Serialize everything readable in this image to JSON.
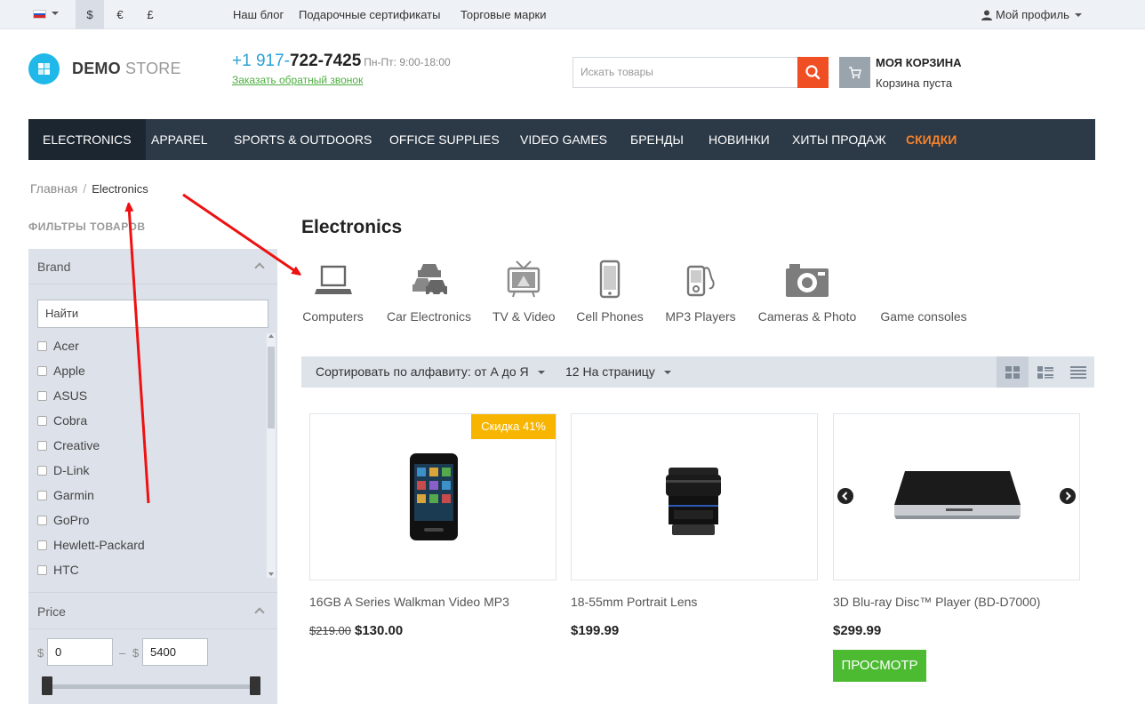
{
  "topbar": {
    "currencies": [
      "$",
      "€",
      "£"
    ],
    "links": [
      "Наш блог",
      "Подарочные сертификаты",
      "Торговые марки"
    ],
    "profile_label": "Мой профиль"
  },
  "header": {
    "logo_bold": "DEMO",
    "logo_light": "STORE",
    "phone_prefix": "+1 917-",
    "phone_number": "722-7425",
    "hours": "Пн-Пт: 9:00-18:00",
    "callback_link": "Заказать обратный звонок",
    "search_placeholder": "Искать товары",
    "cart_title": "МОЯ КОРЗИНА",
    "cart_status": "Корзина пуста"
  },
  "nav": [
    "ELECTRONICS",
    "APPAREL",
    "SPORTS & OUTDOORS",
    "OFFICE SUPPLIES",
    "VIDEO GAMES",
    "БРЕНДЫ",
    "НОВИНКИ",
    "ХИТЫ ПРОДАЖ",
    "СКИДКИ"
  ],
  "breadcrumb": {
    "home": "Главная",
    "separator": "/",
    "current": "Electronics"
  },
  "filters": {
    "title": "ФИЛЬТРЫ ТОВАРОВ",
    "brand_heading": "Brand",
    "brand_search_placeholder": "Найти",
    "brands": [
      "Acer",
      "Apple",
      "ASUS",
      "Cobra",
      "Creative",
      "D-Link",
      "Garmin",
      "GoPro",
      "Hewlett-Packard",
      "HTC"
    ],
    "price_heading": "Price",
    "currency_symbol": "$",
    "price_dash": "–",
    "price_min": "0",
    "price_max": "5400"
  },
  "content": {
    "title": "Electronics",
    "categories": [
      "Computers",
      "Car Electronics",
      "TV & Video",
      "Cell Phones",
      "MP3 Players",
      "Cameras & Photo",
      "Game consoles"
    ],
    "sort_label": "Сортировать по алфавиту: от А до Я",
    "per_page_label": "12 На страницу",
    "products": [
      {
        "name": "16GB A Series Walkman Video MP3",
        "old_price": "$219.00",
        "price": "$130.00",
        "badge": "Скидка 41%"
      },
      {
        "name": "18-55mm Portrait Lens",
        "price": "$199.99"
      },
      {
        "name": "3D Blu-ray Disc™ Player (BD-D7000)",
        "price": "$299.99",
        "button": "ПРОСМОТР"
      }
    ]
  },
  "icons": [
    "flag-ru-icon",
    "user-icon",
    "search-icon",
    "cart-icon",
    "grid-view-icon",
    "list-view-icon",
    "compact-view-icon",
    "arrow-annotation-icon"
  ],
  "colors": {
    "nav_bg": "#2c3947",
    "sale": "#f5822a",
    "search_btn": "#f04e23",
    "badge": "#f7b500",
    "view_btn": "#4cbb32",
    "annotation": "#ee1111"
  }
}
